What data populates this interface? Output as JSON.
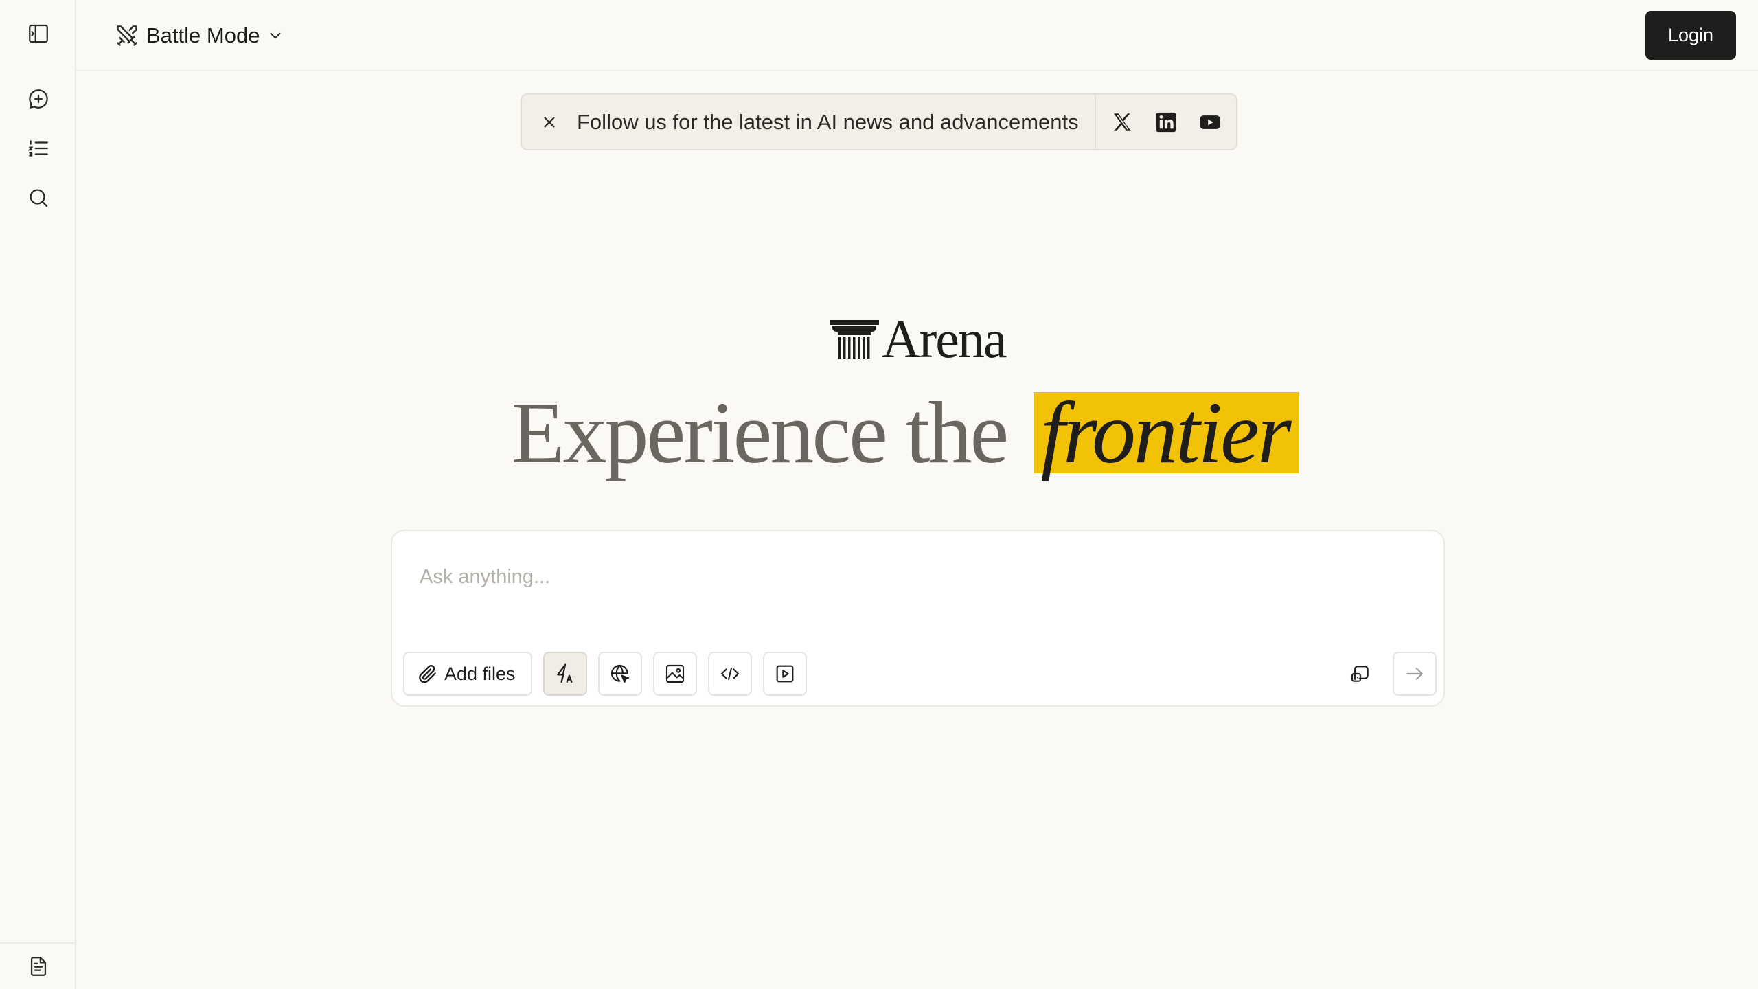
{
  "header": {
    "mode_label": "Battle Mode",
    "login_label": "Login"
  },
  "sidebar": {
    "items": [
      {
        "name": "toggle-sidebar",
        "icon": "sidebar-panel-icon"
      },
      {
        "name": "new-chat",
        "icon": "chat-plus-icon"
      },
      {
        "name": "leaderboard",
        "icon": "numbered-list-icon"
      },
      {
        "name": "search",
        "icon": "search-icon"
      },
      {
        "name": "terms",
        "icon": "document-icon"
      }
    ]
  },
  "banner": {
    "text": "Follow us for the latest in AI news and advancements",
    "social": [
      "x-icon",
      "linkedin-icon",
      "youtube-icon"
    ]
  },
  "hero": {
    "logo_text": "Arena",
    "headline_prefix": "Experience the",
    "headline_highlight": "frontier",
    "highlight_color": "#f2c206"
  },
  "prompt": {
    "placeholder": "Ask anything...",
    "value": "",
    "add_files_label": "Add files"
  },
  "colors": {
    "background": "#faf9f6",
    "primary_button": "#1f1e1c",
    "headline": "#6b6660"
  }
}
